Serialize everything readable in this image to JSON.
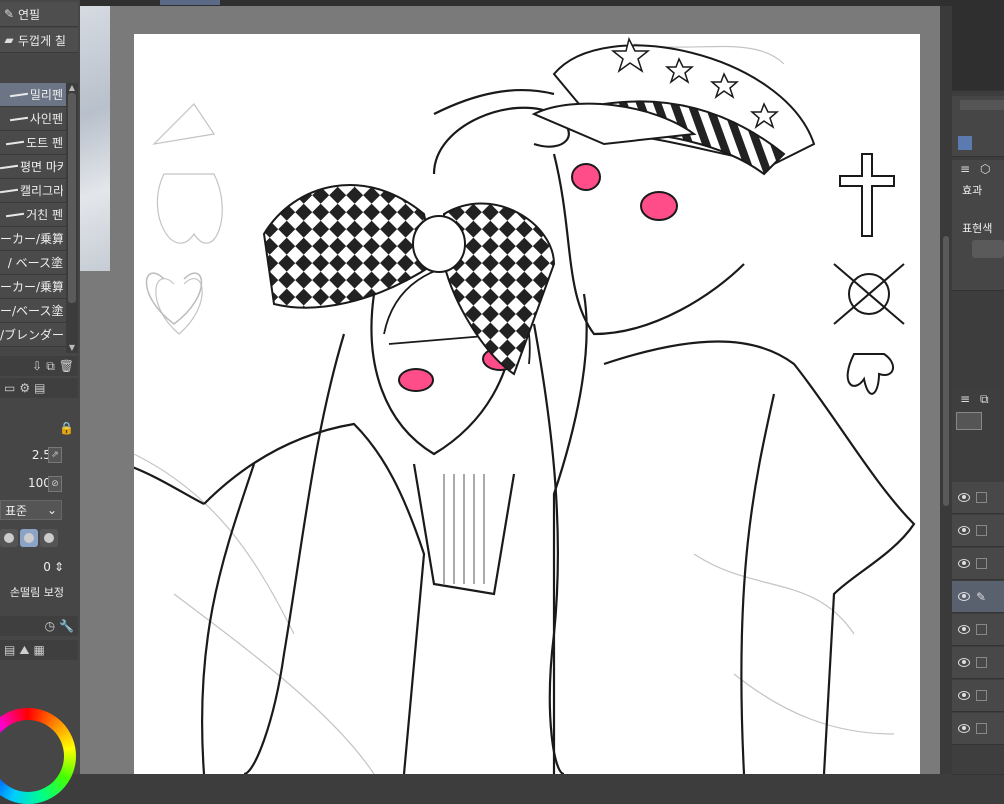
{
  "left_panel": {
    "subtools": [
      {
        "icon": "pencil-icon",
        "label": "연필"
      },
      {
        "icon": "marker-icon",
        "label": "두껍게 칠"
      }
    ],
    "brushes": [
      {
        "label": "밀리펜",
        "selected": true
      },
      {
        "label": "사인펜",
        "selected": false
      },
      {
        "label": "도트 펜",
        "selected": false
      },
      {
        "label": "평면 마커",
        "selected": false
      },
      {
        "label": "캘리그라피",
        "selected": false
      },
      {
        "label": "거친 펜",
        "selected": false
      },
      {
        "label": "ーカー/乗算",
        "selected": false
      },
      {
        "label": "/ ベース塗",
        "selected": false
      },
      {
        "label": "ーカー/乗算",
        "selected": false
      },
      {
        "label": "ー/ベース塗",
        "selected": false
      },
      {
        "label": "/ブレンダー",
        "selected": false
      }
    ],
    "properties": {
      "brush_size": "2.5",
      "opacity": "100",
      "blend_mode": "표준",
      "value_zero": "0",
      "stabilization_label": "손떨림 보정"
    }
  },
  "right_panel": {
    "effect_label": "효과",
    "expression_color_label": "표현색"
  },
  "colors": {
    "accent": "#6b7586",
    "canvas": "#ffffff",
    "panel": "#464646",
    "eyes": "#ff4d8a"
  }
}
